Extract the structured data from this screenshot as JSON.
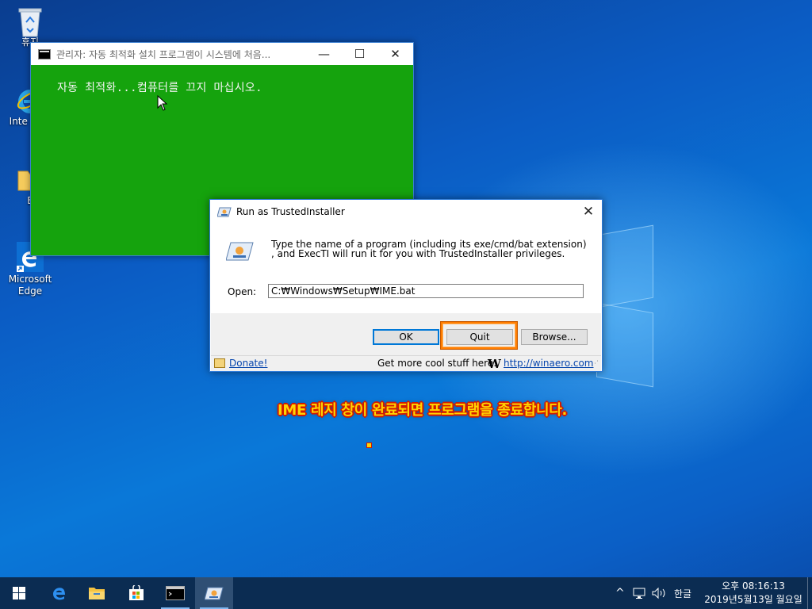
{
  "desktop": {
    "icons": [
      {
        "label": "휴지"
      },
      {
        "label": "Inte Expl"
      },
      {
        "label": "E"
      },
      {
        "label": "Microsoft Edge"
      }
    ]
  },
  "console": {
    "title": "관리자:      자동  최적화 설치 프로그램이 시스템에 처음...",
    "body": "자동 최적화...컴퓨터를 끄지 마십시오.",
    "minimize": "—",
    "maximize": "☐",
    "close": "✕"
  },
  "dialog": {
    "title": "Run as TrustedInstaller",
    "close": "✕",
    "message": "Type the name of a program (including its exe/cmd/bat extension) , and ExecTI will run it for you with TrustedInstaller privileges.",
    "open_label": "Open:",
    "open_value": "C:₩Windows₩Setup₩IME.bat",
    "ok_label": "OK",
    "quit_label": "Quit",
    "browse_label": "Browse...",
    "donate_label": "Donate!",
    "more_text": "Get more cool stuff here:",
    "winaero_logo": "W",
    "winaero_link": "http://winaero.com"
  },
  "caption": "IME 레지 창이 완료되면 프로그램을 종료합니다.",
  "taskbar": {
    "ime_label": "한글",
    "time": "오후 08:16:13",
    "date": "2019년5월13일 월요일",
    "accent": "#0b2c52"
  }
}
